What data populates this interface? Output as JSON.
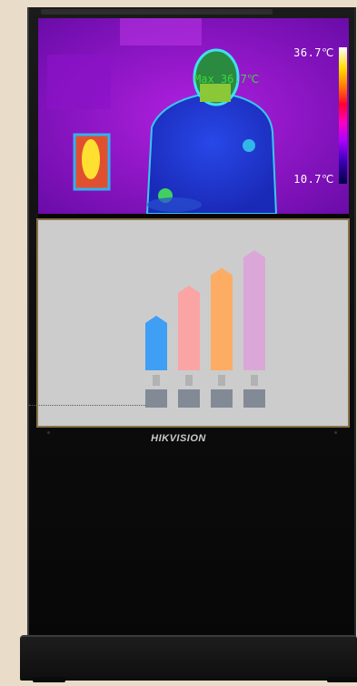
{
  "thermal": {
    "max_label": "36.7℃",
    "min_label": "10.7℃",
    "max_readout": "Max 36.7℃"
  },
  "brand": "HIKVISION",
  "infographic": {
    "bars": [
      {
        "level": 0.4,
        "color": "#3f9ff5"
      },
      {
        "level": 0.62,
        "color": "#fba4a4"
      },
      {
        "level": 0.75,
        "color": "#fdac64"
      },
      {
        "level": 0.88,
        "color": "#dba7d9"
      }
    ],
    "box_color": "#828a96"
  }
}
